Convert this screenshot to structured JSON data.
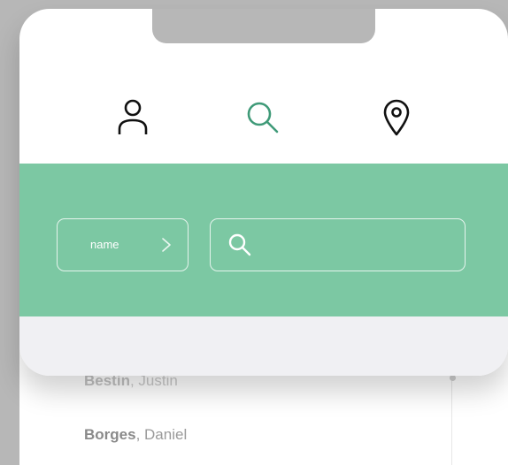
{
  "nav": {
    "icons": [
      "user-icon",
      "search-icon",
      "location-pin-icon"
    ],
    "active": "search-icon"
  },
  "filter": {
    "label": "name",
    "icon": "chevron-right-icon"
  },
  "search": {
    "icon": "search-icon",
    "placeholder": "",
    "value": ""
  },
  "list": {
    "items": [
      {
        "last": "Bestin",
        "first": ", Justin"
      },
      {
        "last": "Borges",
        "first": ", Daniel"
      }
    ]
  },
  "colors": {
    "accent": "#7cc8a3",
    "background": "#b7b7b7",
    "icon_dark": "#111111",
    "icon_active": "#3f9a78"
  }
}
